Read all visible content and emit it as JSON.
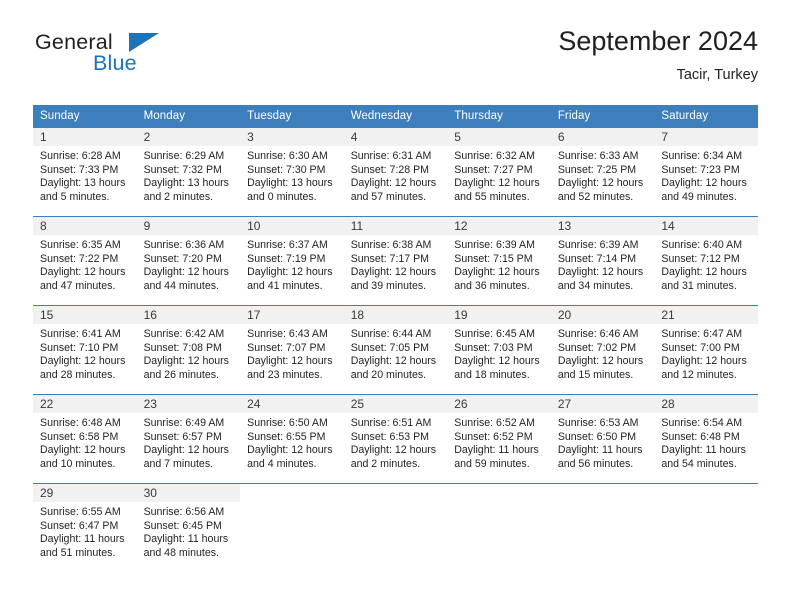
{
  "brand": {
    "name_top": "General",
    "name_bottom": "Blue",
    "accent_color": "#1b73ba"
  },
  "header": {
    "title": "September 2024",
    "subtitle": "Tacir, Turkey"
  },
  "theme": {
    "header_blue": "#3d7ebc",
    "daynum_band": "#f1f1f1",
    "text": "#231f20"
  },
  "calendar": {
    "weekday_headers": [
      "Sunday",
      "Monday",
      "Tuesday",
      "Wednesday",
      "Thursday",
      "Friday",
      "Saturday"
    ],
    "weeks": [
      [
        {
          "day": "1",
          "sunrise": "Sunrise: 6:28 AM",
          "sunset": "Sunset: 7:33 PM",
          "daylight_line1": "Daylight: 13 hours",
          "daylight_line2": "and 5 minutes."
        },
        {
          "day": "2",
          "sunrise": "Sunrise: 6:29 AM",
          "sunset": "Sunset: 7:32 PM",
          "daylight_line1": "Daylight: 13 hours",
          "daylight_line2": "and 2 minutes."
        },
        {
          "day": "3",
          "sunrise": "Sunrise: 6:30 AM",
          "sunset": "Sunset: 7:30 PM",
          "daylight_line1": "Daylight: 13 hours",
          "daylight_line2": "and 0 minutes."
        },
        {
          "day": "4",
          "sunrise": "Sunrise: 6:31 AM",
          "sunset": "Sunset: 7:28 PM",
          "daylight_line1": "Daylight: 12 hours",
          "daylight_line2": "and 57 minutes."
        },
        {
          "day": "5",
          "sunrise": "Sunrise: 6:32 AM",
          "sunset": "Sunset: 7:27 PM",
          "daylight_line1": "Daylight: 12 hours",
          "daylight_line2": "and 55 minutes."
        },
        {
          "day": "6",
          "sunrise": "Sunrise: 6:33 AM",
          "sunset": "Sunset: 7:25 PM",
          "daylight_line1": "Daylight: 12 hours",
          "daylight_line2": "and 52 minutes."
        },
        {
          "day": "7",
          "sunrise": "Sunrise: 6:34 AM",
          "sunset": "Sunset: 7:23 PM",
          "daylight_line1": "Daylight: 12 hours",
          "daylight_line2": "and 49 minutes."
        }
      ],
      [
        {
          "day": "8",
          "sunrise": "Sunrise: 6:35 AM",
          "sunset": "Sunset: 7:22 PM",
          "daylight_line1": "Daylight: 12 hours",
          "daylight_line2": "and 47 minutes."
        },
        {
          "day": "9",
          "sunrise": "Sunrise: 6:36 AM",
          "sunset": "Sunset: 7:20 PM",
          "daylight_line1": "Daylight: 12 hours",
          "daylight_line2": "and 44 minutes."
        },
        {
          "day": "10",
          "sunrise": "Sunrise: 6:37 AM",
          "sunset": "Sunset: 7:19 PM",
          "daylight_line1": "Daylight: 12 hours",
          "daylight_line2": "and 41 minutes."
        },
        {
          "day": "11",
          "sunrise": "Sunrise: 6:38 AM",
          "sunset": "Sunset: 7:17 PM",
          "daylight_line1": "Daylight: 12 hours",
          "daylight_line2": "and 39 minutes."
        },
        {
          "day": "12",
          "sunrise": "Sunrise: 6:39 AM",
          "sunset": "Sunset: 7:15 PM",
          "daylight_line1": "Daylight: 12 hours",
          "daylight_line2": "and 36 minutes."
        },
        {
          "day": "13",
          "sunrise": "Sunrise: 6:39 AM",
          "sunset": "Sunset: 7:14 PM",
          "daylight_line1": "Daylight: 12 hours",
          "daylight_line2": "and 34 minutes."
        },
        {
          "day": "14",
          "sunrise": "Sunrise: 6:40 AM",
          "sunset": "Sunset: 7:12 PM",
          "daylight_line1": "Daylight: 12 hours",
          "daylight_line2": "and 31 minutes."
        }
      ],
      [
        {
          "day": "15",
          "sunrise": "Sunrise: 6:41 AM",
          "sunset": "Sunset: 7:10 PM",
          "daylight_line1": "Daylight: 12 hours",
          "daylight_line2": "and 28 minutes."
        },
        {
          "day": "16",
          "sunrise": "Sunrise: 6:42 AM",
          "sunset": "Sunset: 7:08 PM",
          "daylight_line1": "Daylight: 12 hours",
          "daylight_line2": "and 26 minutes."
        },
        {
          "day": "17",
          "sunrise": "Sunrise: 6:43 AM",
          "sunset": "Sunset: 7:07 PM",
          "daylight_line1": "Daylight: 12 hours",
          "daylight_line2": "and 23 minutes."
        },
        {
          "day": "18",
          "sunrise": "Sunrise: 6:44 AM",
          "sunset": "Sunset: 7:05 PM",
          "daylight_line1": "Daylight: 12 hours",
          "daylight_line2": "and 20 minutes."
        },
        {
          "day": "19",
          "sunrise": "Sunrise: 6:45 AM",
          "sunset": "Sunset: 7:03 PM",
          "daylight_line1": "Daylight: 12 hours",
          "daylight_line2": "and 18 minutes."
        },
        {
          "day": "20",
          "sunrise": "Sunrise: 6:46 AM",
          "sunset": "Sunset: 7:02 PM",
          "daylight_line1": "Daylight: 12 hours",
          "daylight_line2": "and 15 minutes."
        },
        {
          "day": "21",
          "sunrise": "Sunrise: 6:47 AM",
          "sunset": "Sunset: 7:00 PM",
          "daylight_line1": "Daylight: 12 hours",
          "daylight_line2": "and 12 minutes."
        }
      ],
      [
        {
          "day": "22",
          "sunrise": "Sunrise: 6:48 AM",
          "sunset": "Sunset: 6:58 PM",
          "daylight_line1": "Daylight: 12 hours",
          "daylight_line2": "and 10 minutes."
        },
        {
          "day": "23",
          "sunrise": "Sunrise: 6:49 AM",
          "sunset": "Sunset: 6:57 PM",
          "daylight_line1": "Daylight: 12 hours",
          "daylight_line2": "and 7 minutes."
        },
        {
          "day": "24",
          "sunrise": "Sunrise: 6:50 AM",
          "sunset": "Sunset: 6:55 PM",
          "daylight_line1": "Daylight: 12 hours",
          "daylight_line2": "and 4 minutes."
        },
        {
          "day": "25",
          "sunrise": "Sunrise: 6:51 AM",
          "sunset": "Sunset: 6:53 PM",
          "daylight_line1": "Daylight: 12 hours",
          "daylight_line2": "and 2 minutes."
        },
        {
          "day": "26",
          "sunrise": "Sunrise: 6:52 AM",
          "sunset": "Sunset: 6:52 PM",
          "daylight_line1": "Daylight: 11 hours",
          "daylight_line2": "and 59 minutes."
        },
        {
          "day": "27",
          "sunrise": "Sunrise: 6:53 AM",
          "sunset": "Sunset: 6:50 PM",
          "daylight_line1": "Daylight: 11 hours",
          "daylight_line2": "and 56 minutes."
        },
        {
          "day": "28",
          "sunrise": "Sunrise: 6:54 AM",
          "sunset": "Sunset: 6:48 PM",
          "daylight_line1": "Daylight: 11 hours",
          "daylight_line2": "and 54 minutes."
        }
      ],
      [
        {
          "day": "29",
          "sunrise": "Sunrise: 6:55 AM",
          "sunset": "Sunset: 6:47 PM",
          "daylight_line1": "Daylight: 11 hours",
          "daylight_line2": "and 51 minutes."
        },
        {
          "day": "30",
          "sunrise": "Sunrise: 6:56 AM",
          "sunset": "Sunset: 6:45 PM",
          "daylight_line1": "Daylight: 11 hours",
          "daylight_line2": "and 48 minutes."
        },
        {
          "day": "",
          "sunrise": "",
          "sunset": "",
          "daylight_line1": "",
          "daylight_line2": ""
        },
        {
          "day": "",
          "sunrise": "",
          "sunset": "",
          "daylight_line1": "",
          "daylight_line2": ""
        },
        {
          "day": "",
          "sunrise": "",
          "sunset": "",
          "daylight_line1": "",
          "daylight_line2": ""
        },
        {
          "day": "",
          "sunrise": "",
          "sunset": "",
          "daylight_line1": "",
          "daylight_line2": ""
        },
        {
          "day": "",
          "sunrise": "",
          "sunset": "",
          "daylight_line1": "",
          "daylight_line2": ""
        }
      ]
    ]
  }
}
